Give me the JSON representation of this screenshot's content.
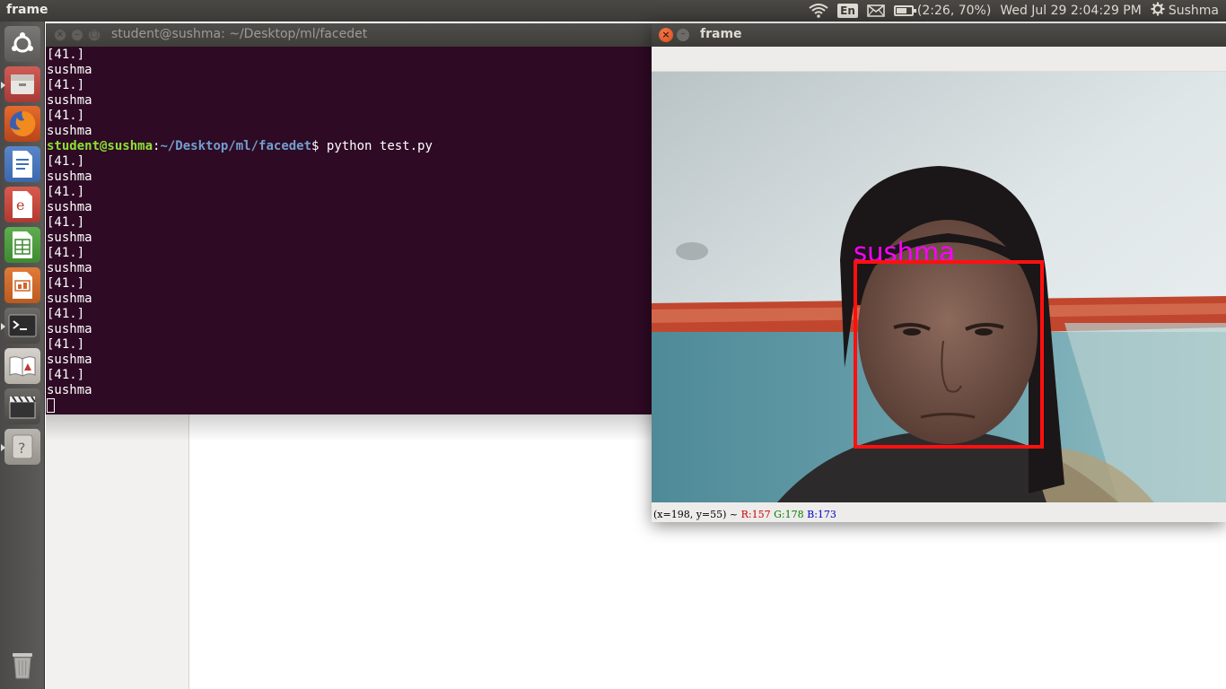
{
  "top_panel": {
    "app_title": "frame",
    "language": "En",
    "battery": "(2:26, 70%)",
    "battery_fraction": 0.7,
    "datetime": "Wed Jul 29  2:04:29 PM",
    "user": "Sushma",
    "icons": [
      "wifi-icon",
      "mail-icon",
      "battery-icon",
      "gear-icon"
    ]
  },
  "launcher": {
    "items": [
      "dash-icon",
      "files-icon",
      "firefox-icon",
      "writer-icon",
      "calc-icon-e",
      "calc-icon",
      "impress-icon",
      "terminal-icon",
      "document-viewer-icon",
      "videos-icon",
      "help-icon",
      "trash-icon"
    ]
  },
  "terminal": {
    "title": "student@sushma: ~/Desktop/ml/facedet",
    "prompt_user": "student@sushma",
    "prompt_path": "~/Desktop/ml/facedet",
    "prompt_command": "$ python test.py",
    "lines_before": [
      "[41.]",
      "sushma",
      "[41.]",
      "sushma",
      "[41.]",
      "sushma"
    ],
    "lines_after": [
      "[41.]",
      "sushma",
      "[41.]",
      "sushma",
      "[41.]",
      "sushma",
      "[41.]",
      "sushma",
      "[41.]",
      "sushma",
      "[41.]",
      "sushma",
      "[41.]",
      "sushma",
      "[41.]",
      "sushma"
    ]
  },
  "frame_window": {
    "title": "frame",
    "face_label": "sushma",
    "status": {
      "coords": "(x=198, y=55) ~",
      "r": "R:157",
      "g": "G:178",
      "b": "B:173"
    }
  },
  "colors": {
    "terminal_bg": "#2e0a24",
    "prompt_user": "#8ae234",
    "prompt_path": "#729fcf",
    "face_label": "#ff00ff",
    "face_box": "#ff1010",
    "close_button": "#e2531d"
  }
}
